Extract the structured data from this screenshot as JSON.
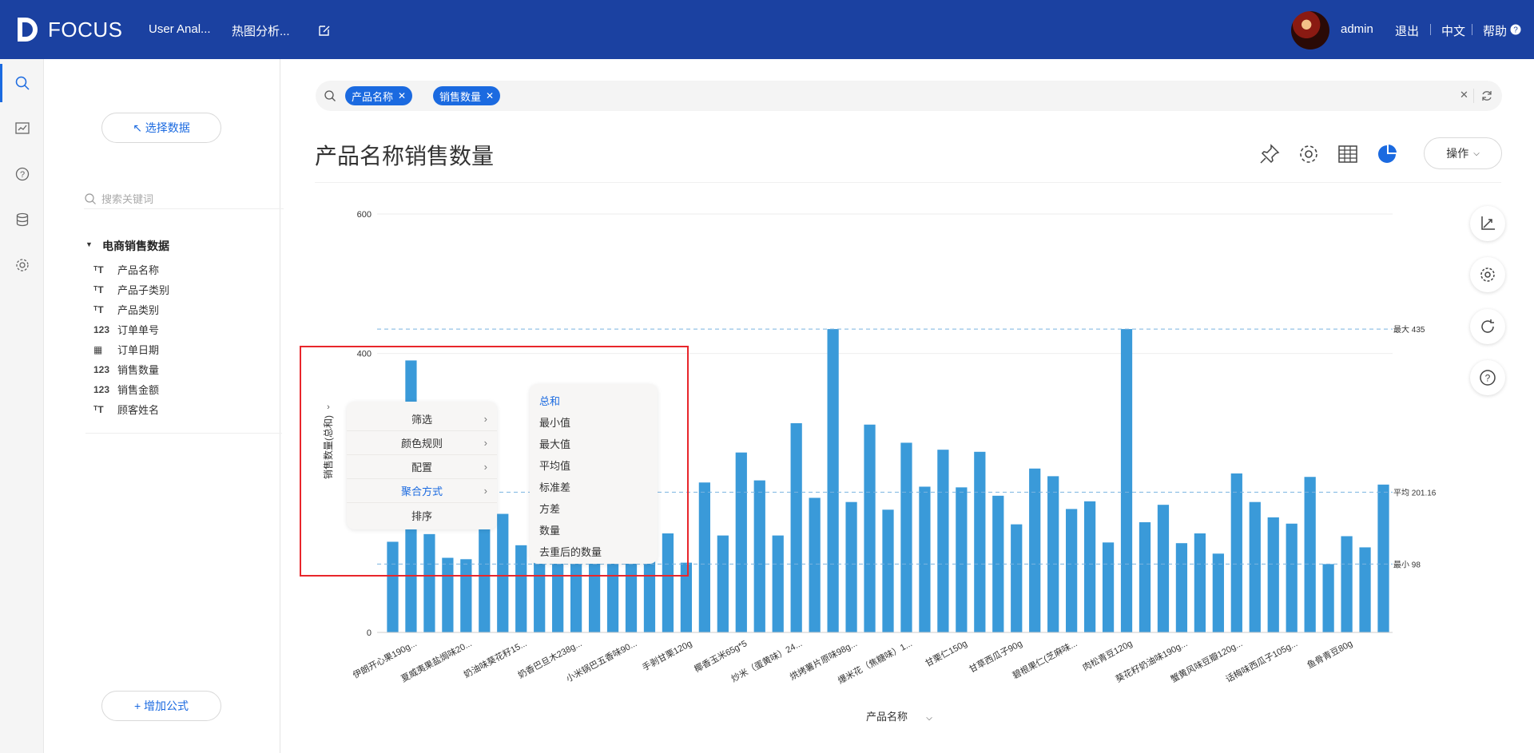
{
  "app": {
    "logo": "FOCUS"
  },
  "nav": {
    "tab1": "User Anal...",
    "tab2": "热图分析..."
  },
  "topright": {
    "user": "admin",
    "logout": "退出",
    "lang": "中文",
    "help": "帮助"
  },
  "leftpanel": {
    "select_data": "↖ 选择数据",
    "search_placeholder": "搜索关键词",
    "tree_title": "电商销售数据",
    "fields": [
      {
        "type": "T",
        "label": "产品名称"
      },
      {
        "type": "T",
        "label": "产品子类别"
      },
      {
        "type": "T",
        "label": "产品类别"
      },
      {
        "type": "123",
        "label": "订单单号"
      },
      {
        "type": "date",
        "label": "订单日期"
      },
      {
        "type": "123",
        "label": "销售数量"
      },
      {
        "type": "123",
        "label": "销售金额"
      },
      {
        "type": "T",
        "label": "顾客姓名"
      }
    ],
    "add_formula": "+ 增加公式"
  },
  "search": {
    "tags": [
      "产品名称",
      "销售数量"
    ]
  },
  "page": {
    "title": "产品名称销售数量",
    "operate": "操作"
  },
  "context_menu": {
    "items": [
      "筛选",
      "颜色规则",
      "配置",
      "聚合方式",
      "排序"
    ],
    "active": "聚合方式"
  },
  "submenu": {
    "items": [
      "总和",
      "最小值",
      "最大值",
      "平均值",
      "标准差",
      "方差",
      "数量",
      "去重后的数量"
    ],
    "active": "总和"
  },
  "chart_data": {
    "type": "bar",
    "xlabel": "产品名称",
    "ylabel": "销售数量(总和)",
    "ylim": [
      0,
      600
    ],
    "yticks": [
      0,
      400,
      600
    ],
    "color": "#3a9ad9",
    "reference_lines": [
      {
        "label": "最大 435",
        "value": 435
      },
      {
        "label": "平均 201.16",
        "value": 201.16
      },
      {
        "label": "最小 98",
        "value": 98
      }
    ],
    "x_tick_labels": [
      "伊朗开心果190g...",
      "夏威夷果盐焗味20...",
      "奶油味葵花籽15...",
      "奶香巴旦木238g...",
      "小米锅巴五香味90...",
      "手剥甘栗120g",
      "椰香玉米65g*5",
      "炒米（蛋黄味）24...",
      "烘烤薯片原味98g...",
      "爆米花（焦糖味）1...",
      "甘栗仁150g",
      "甘草西瓜子90g",
      "碧根果仁(芝麻味...",
      "肉松青豆120g",
      "葵花籽奶油味190g...",
      "蟹黄风味豆瓣120g...",
      "话梅味西瓜子105g...",
      "鱼骨青豆80g"
    ],
    "values": [
      130,
      390,
      141,
      107,
      105,
      160,
      170,
      125,
      255,
      268,
      222,
      148,
      166,
      127,
      139,
      142,
      100,
      215,
      139,
      258,
      218,
      139,
      300,
      193,
      435,
      187,
      298,
      176,
      272,
      209,
      262,
      208,
      259,
      196,
      155,
      235,
      224,
      177,
      188,
      129,
      435,
      158,
      183,
      128,
      142,
      113,
      228,
      187,
      165,
      156,
      223,
      98,
      138,
      122,
      212
    ]
  }
}
